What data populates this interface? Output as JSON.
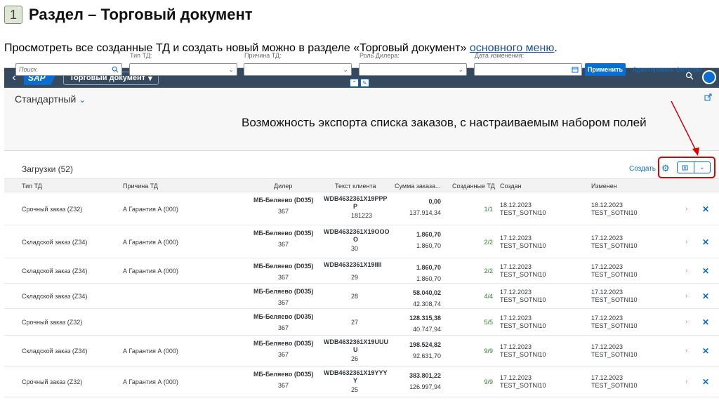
{
  "slide": {
    "number": "1",
    "title": "Раздел – Торговый документ",
    "intro_text": "Просмотреть все созданные ТД и  создать новый можно в разделе «Торговый документ» ",
    "intro_link": "основного меню",
    "intro_end": "."
  },
  "shell": {
    "back": "‹",
    "logo": "SAP",
    "app_title": "Торговый документ",
    "app_caret": "▾"
  },
  "filter": {
    "variant": "Стандартный",
    "variant_caret": "⌄",
    "export_note": "Возможность экспорта списка заказов, с настраиваемым набором полей",
    "search_placeholder": "Поиск",
    "labels": {
      "type": "Тип ТД:",
      "reason": "Причина ТД:",
      "role": "Роль Дилера:",
      "date": "Дата изменения:"
    },
    "apply": "Применить",
    "adapt": "Адаптировать фильтры"
  },
  "table": {
    "title": "Загрузки (52)",
    "create": "Создать",
    "columns": [
      "Тип ТД",
      "Причина ТД",
      "Дилер",
      "Текст клиента",
      "Сумма заказа...",
      "Созданные ТД",
      "Создан",
      "Изменен"
    ],
    "rows": [
      {
        "type": "Срочный заказ (Z32)",
        "reason": "А Гарантия А (000)",
        "dealer": "МБ-Беляево (D035)",
        "dealer_code": "367",
        "text1": "WDB4632361X19PPP",
        "text2": "P",
        "text3": "181223",
        "sum1": "0,00",
        "sum2": "137.914,34",
        "td": "1/1",
        "created_date": "18.12.2023",
        "created_by": "TEST_SOTNI10",
        "changed_date": "18.12.2023",
        "changed_by": "TEST_SOTNI10"
      },
      {
        "type": "Складской заказ (Z34)",
        "reason": "А Гарантия А (000)",
        "dealer": "МБ-Беляево (D035)",
        "dealer_code": "367",
        "text1": "WDB4632361X19OOO",
        "text2": "O",
        "text3": "30",
        "sum1": "1.860,70",
        "sum2": "1.860,70",
        "td": "2/2",
        "created_date": "17.12.2023",
        "created_by": "TEST_SOTNI10",
        "changed_date": "17.12.2023",
        "changed_by": "TEST_SOTNI10"
      },
      {
        "type": "Складской заказ (Z34)",
        "reason": "А Гарантия А (000)",
        "dealer": "МБ-Беляево (D035)",
        "dealer_code": "367",
        "text1": "WDB4632361X19IIII",
        "text2": "",
        "text3": "29",
        "sum1": "1.860,70",
        "sum2": "1.860,70",
        "td": "2/2",
        "created_date": "17.12.2023",
        "created_by": "TEST_SOTNI10",
        "changed_date": "17.12.2023",
        "changed_by": "TEST_SOTNI10"
      },
      {
        "type": "Складской заказ (Z34)",
        "reason": "",
        "dealer": "МБ-Беляево (D035)",
        "dealer_code": "367",
        "text1": "",
        "text2": "",
        "text3": "28",
        "sum1": "58.040,02",
        "sum2": "42.308,74",
        "td": "4/4",
        "created_date": "17.12.2023",
        "created_by": "TEST_SOTNI10",
        "changed_date": "17.12.2023",
        "changed_by": "TEST_SOTNI10"
      },
      {
        "type": "Срочный заказ (Z32)",
        "reason": "",
        "dealer": "МБ-Беляево (D035)",
        "dealer_code": "367",
        "text1": "",
        "text2": "",
        "text3": "27",
        "sum1": "128.315,38",
        "sum2": "40.747,94",
        "td": "5/5",
        "created_date": "17.12.2023",
        "created_by": "TEST_SOTNI10",
        "changed_date": "17.12.2023",
        "changed_by": "TEST_SOTNI10"
      },
      {
        "type": "Складской заказ (Z34)",
        "reason": "А Гарантия А (000)",
        "dealer": "МБ-Беляево (D035)",
        "dealer_code": "367",
        "text1": "WDB4632361X19UUU",
        "text2": "U",
        "text3": "26",
        "sum1": "198.524,82",
        "sum2": "92.631,70",
        "td": "9/9",
        "created_date": "17.12.2023",
        "created_by": "TEST_SOTNI10",
        "changed_date": "17.12.2023",
        "changed_by": "TEST_SOTNI10"
      },
      {
        "type": "Срочный заказ (Z32)",
        "reason": "А Гарантия А (000)",
        "dealer": "МБ-Беляево (D035)",
        "dealer_code": "367",
        "text1": "WDB4632361X19YYY",
        "text2": "Y",
        "text3": "25",
        "sum1": "383.801,22",
        "sum2": "126.997,94",
        "td": "9/9",
        "created_date": "17.12.2023",
        "created_by": "TEST_SOTNI10",
        "changed_date": "17.12.2023",
        "changed_by": "TEST_SOTNI10"
      }
    ]
  },
  "icons": {
    "search": "search-icon",
    "gear": "gear-icon",
    "export": "export-icon",
    "delete": "close-icon",
    "navigate": "chevron-right-icon"
  },
  "colors": {
    "shell": "#354a5f",
    "accent": "#0a6ed1",
    "highlight": "#dd0000",
    "positive": "#2b7d2b"
  }
}
